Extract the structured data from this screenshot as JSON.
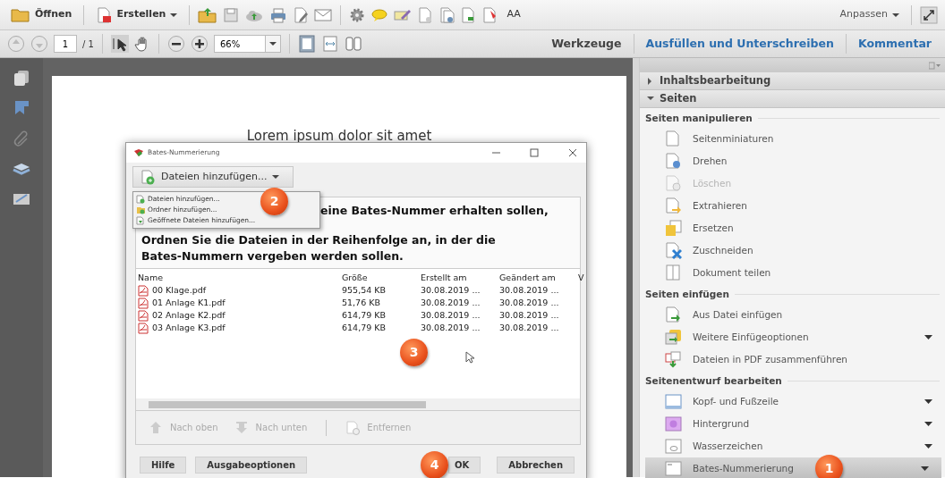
{
  "toolbar": {
    "open_button": "Öffnen",
    "create_button": "Erstellen",
    "customize_button": "Anpassen",
    "font_size_button": "AA"
  },
  "navigation": {
    "page": "1",
    "page_total": "/ 1",
    "zoom": "66%",
    "tabs": [
      {
        "label": "Werkzeuge",
        "selected": true
      },
      {
        "label": "Ausfüllen und Unterschreiben",
        "selected": false
      },
      {
        "label": "Kommentar",
        "selected": false
      }
    ]
  },
  "document": {
    "heading": "Lorem ipsum dolor sit amet"
  },
  "dialog": {
    "title": "Bates-Nummerierung",
    "add_button": "Dateien hinzufügen...",
    "add_callout": "2",
    "add_menu": [
      {
        "label": "Dateien hinzufügen...",
        "kind": "file"
      },
      {
        "label": "Ordner hinzufügen...",
        "kind": "folder"
      },
      {
        "label": "Geöffnete Dateien hinzufügen...",
        "kind": "open"
      }
    ],
    "instruction_partial": "eine Bates-Nummer erhalten sollen,",
    "instruction": "Ordnen Sie die Dateien in der Reihenfolge an, in der die Bates-Nummern vergeben werden sollen.",
    "table": {
      "columns": [
        "Name",
        "Größe",
        "Erstellt am",
        "Geändert am",
        "V"
      ],
      "callout": "3",
      "rows": [
        [
          "00 Klage.pdf",
          "955,54 KB",
          "30.08.2019 ...",
          "30.08.2019 ..."
        ],
        [
          "01 Anlage K1.pdf",
          "51,76 KB",
          "30.08.2019 ...",
          "30.08.2019 ..."
        ],
        [
          "02 Anlage K2.pdf",
          "614,79 KB",
          "30.08.2019 ...",
          "30.08.2019 ..."
        ],
        [
          "03 Anlage K3.pdf",
          "614,79 KB",
          "30.08.2019 ...",
          "30.08.2019 ..."
        ]
      ]
    },
    "list_buttons": [
      {
        "label": "Nach oben",
        "kind": "up",
        "disabled": true
      },
      {
        "label": "Nach unten",
        "kind": "down",
        "disabled": true
      },
      {
        "label": "Entfernen",
        "kind": "remove",
        "disabled": true
      }
    ],
    "footer_buttons": [
      "Hilfe",
      "Ausgabeoptionen"
    ],
    "ok_button": "OK",
    "ok_callout": "4",
    "cancel_button": "Abbrechen"
  },
  "panel": {
    "groups": [
      {
        "label": "Inhaltsbearbeitung",
        "expanded": false
      },
      {
        "label": "Seiten",
        "expanded": true,
        "sections": [
          {
            "title": "Seiten manipulieren",
            "items": [
              {
                "label": "Seitenminiaturen",
                "kind": "pages",
                "disabled": false,
                "has_menu": false,
                "selected": false
              },
              {
                "label": "Drehen",
                "kind": "rotate",
                "disabled": false,
                "has_menu": false,
                "selected": false
              },
              {
                "label": "Löschen",
                "kind": "delete",
                "disabled": true,
                "has_menu": false,
                "selected": false
              },
              {
                "label": "Extrahieren",
                "kind": "extract",
                "disabled": false,
                "has_menu": false,
                "selected": false
              },
              {
                "label": "Ersetzen",
                "kind": "replace",
                "disabled": false,
                "has_menu": false,
                "selected": false
              },
              {
                "label": "Zuschneiden",
                "kind": "crop",
                "disabled": false,
                "has_menu": false,
                "selected": false
              },
              {
                "label": "Dokument teilen",
                "kind": "split",
                "disabled": false,
                "has_menu": false,
                "selected": false
              }
            ]
          },
          {
            "title": "Seiten einfügen",
            "items": [
              {
                "label": "Aus Datei einfügen",
                "kind": "insert",
                "disabled": false,
                "has_menu": false,
                "selected": false
              },
              {
                "label": "Weitere Einfügeoptionen",
                "kind": "more",
                "disabled": false,
                "has_menu": true,
                "selected": false
              },
              {
                "label": "Dateien in PDF zusammenführen",
                "kind": "merge",
                "disabled": false,
                "has_menu": false,
                "selected": false
              }
            ]
          },
          {
            "title": "Seitenentwurf bearbeiten",
            "items": [
              {
                "label": "Kopf- und Fußzeile",
                "kind": "header",
                "disabled": false,
                "has_menu": true,
                "selected": false
              },
              {
                "label": "Hintergrund",
                "kind": "background",
                "disabled": false,
                "has_menu": true,
                "selected": false
              },
              {
                "label": "Wasserzeichen",
                "kind": "watermark",
                "disabled": false,
                "has_menu": true,
                "selected": false
              },
              {
                "label": "Bates-Nummerierung",
                "kind": "bates",
                "disabled": false,
                "has_menu": true,
                "selected": true,
                "callout": "1"
              }
            ]
          }
        ]
      }
    ]
  }
}
